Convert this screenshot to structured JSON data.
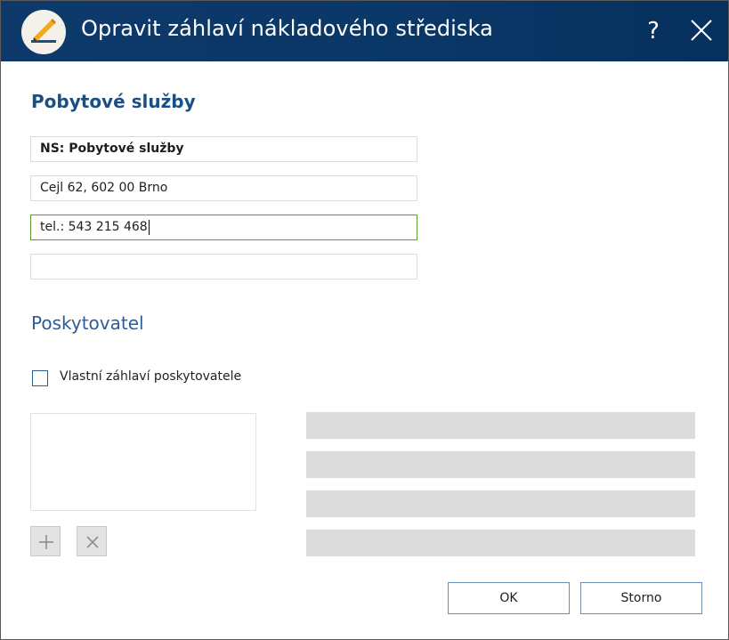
{
  "window": {
    "title": "Opravit záhlaví nákladového střediska",
    "help_label": "?",
    "icons": {
      "app": "pencil-edit-icon",
      "close": "close-icon"
    },
    "colors": {
      "titlebar": "#0b3867",
      "accent": "#1a4f86",
      "active_border": "#5aa02c"
    }
  },
  "header": {
    "heading": "Pobytové služby",
    "fields": [
      {
        "value": "NS: Pobytové služby"
      },
      {
        "value": "Cejl 62, 602 00 Brno"
      },
      {
        "value": "tel.: 543 215 468"
      },
      {
        "value": ""
      }
    ]
  },
  "provider": {
    "section_title": "Poskytovatel",
    "checkbox_label": "Vlastní záhlaví poskytovatele",
    "checkbox_checked": false,
    "add_icon": "plus-icon",
    "remove_icon": "x-icon"
  },
  "footer": {
    "ok_label": "OK",
    "cancel_label": "Storno"
  }
}
